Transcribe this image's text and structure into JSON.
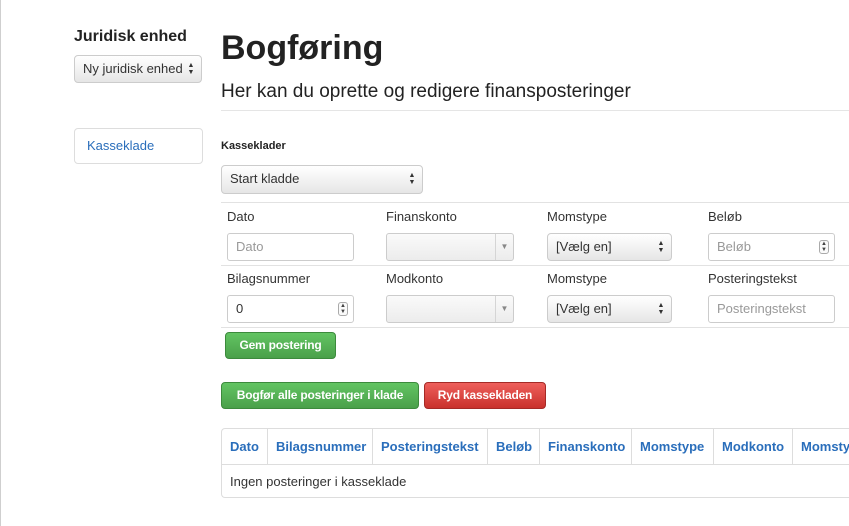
{
  "sidebar": {
    "title": "Juridisk enhed",
    "entity_select": "Ny juridisk enhed",
    "nav_item": "Kasseklade"
  },
  "header": {
    "title": "Bogføring",
    "subtitle": "Her kan du oprette og redigere finansposteringer"
  },
  "kasseklader": {
    "label": "Kasseklader",
    "selected": "Start kladde"
  },
  "form": {
    "row1": {
      "dato_label": "Dato",
      "dato_placeholder": "Dato",
      "finanskonto_label": "Finanskonto",
      "momstype_label": "Momstype",
      "momstype_value": "[Vælg en]",
      "belob_label": "Beløb",
      "belob_placeholder": "Beløb"
    },
    "row2": {
      "bilagsnummer_label": "Bilagsnummer",
      "bilagsnummer_value": "0",
      "modkonto_label": "Modkonto",
      "momstype_label": "Momstype",
      "momstype_value": "[Vælg en]",
      "posteringstekst_label": "Posteringstekst",
      "posteringstekst_placeholder": "Posteringstekst"
    },
    "save_button": "Gem postering"
  },
  "actions": {
    "post_all": "Bogfør alle posteringer i klade",
    "clear": "Ryd kassekladen"
  },
  "table": {
    "columns": [
      "Dato",
      "Bilagsnummer",
      "Posteringstekst",
      "Beløb",
      "Finanskonto",
      "Momstype",
      "Modkonto",
      "Momstype"
    ],
    "empty_text": "Ingen posteringer i kasseklade"
  },
  "colors": {
    "link": "#2a6ebb",
    "success": "#5bb75b",
    "danger": "#da4f49"
  }
}
